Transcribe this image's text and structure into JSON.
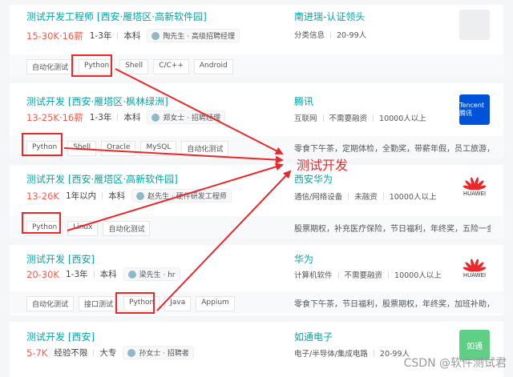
{
  "jobs": [
    {
      "title": "测试开发工程师  [西安·雁塔区·高新软件园]",
      "salary": "15-30K·16薪",
      "experience": "1-3年",
      "education": "本科",
      "recruiter": "陶先生 · 高级招聘经理",
      "company": "南进瑞-认证领头",
      "company_meta": [
        "分类信息",
        "20-99人"
      ],
      "logo_text": "",
      "tags": [
        "自动化测试",
        "Python",
        "Shell",
        "C/C++",
        "Android"
      ],
      "benefits": ""
    },
    {
      "title": "测试开发  [西安·雁塔区·枫林绿洲]",
      "salary": "13-25K·16薪",
      "experience": "1-3年",
      "education": "本科",
      "recruiter": "郑女士 · 招聘经理",
      "company": "腾讯",
      "company_meta": [
        "互联网",
        "不需要融资",
        "10000人以上"
      ],
      "logo_text": "Tencent 腾讯",
      "tags": [
        "Python",
        "Shell",
        "Oracle",
        "MySQL",
        "自动化测试"
      ],
      "benefits": "零食下午茶，定期体检，全勤奖，带薪年假，员工旅游，..."
    },
    {
      "title": "测试开发  [西安·雁塔区·高新软件园]",
      "salary": "13-26K",
      "experience": "1年以内",
      "education": "本科",
      "recruiter": "赵先生 · 硬件研发工程师",
      "company": "西安华为",
      "company_meta": [
        "通信/网络设备",
        "未融资",
        "10000人以上"
      ],
      "logo_text": "HUAWEI",
      "tags": [
        "Python",
        "Linux",
        "自动化测试"
      ],
      "benefits": "股票期权，补充医疗保险，节日福利，年终奖，五险一金..."
    },
    {
      "title": "测试开发  [西安]",
      "salary": "20-30K",
      "experience": "1-3年",
      "education": "本科",
      "recruiter": "梁先生 · hr",
      "company": "华为",
      "company_meta": [
        "计算机软件",
        "不需要融资",
        "10000人以上"
      ],
      "logo_text": "HUAWEI",
      "tags": [
        "自动化测试",
        "接口测试",
        "Python",
        "Java",
        "Appium"
      ],
      "benefits": "零食下午茶，节日福利，股票期权，年终奖，加班补助，..."
    },
    {
      "title": "测试开发  [西安]",
      "salary": "5-7K",
      "experience": "经验不限",
      "education": "大专",
      "recruiter": "孙女士 · 招聘者",
      "company": "如通电子",
      "company_meta": [
        "电子/半导体/集成电路",
        "20-99人"
      ],
      "logo_text": "如通",
      "tags": [],
      "benefits": ""
    }
  ],
  "annotation_label": "测试开发",
  "watermark": "CSDN @软件测试君",
  "colors": {
    "accent": "#00a6a7",
    "salary": "#fe574a",
    "highlight": "#e8282b"
  }
}
